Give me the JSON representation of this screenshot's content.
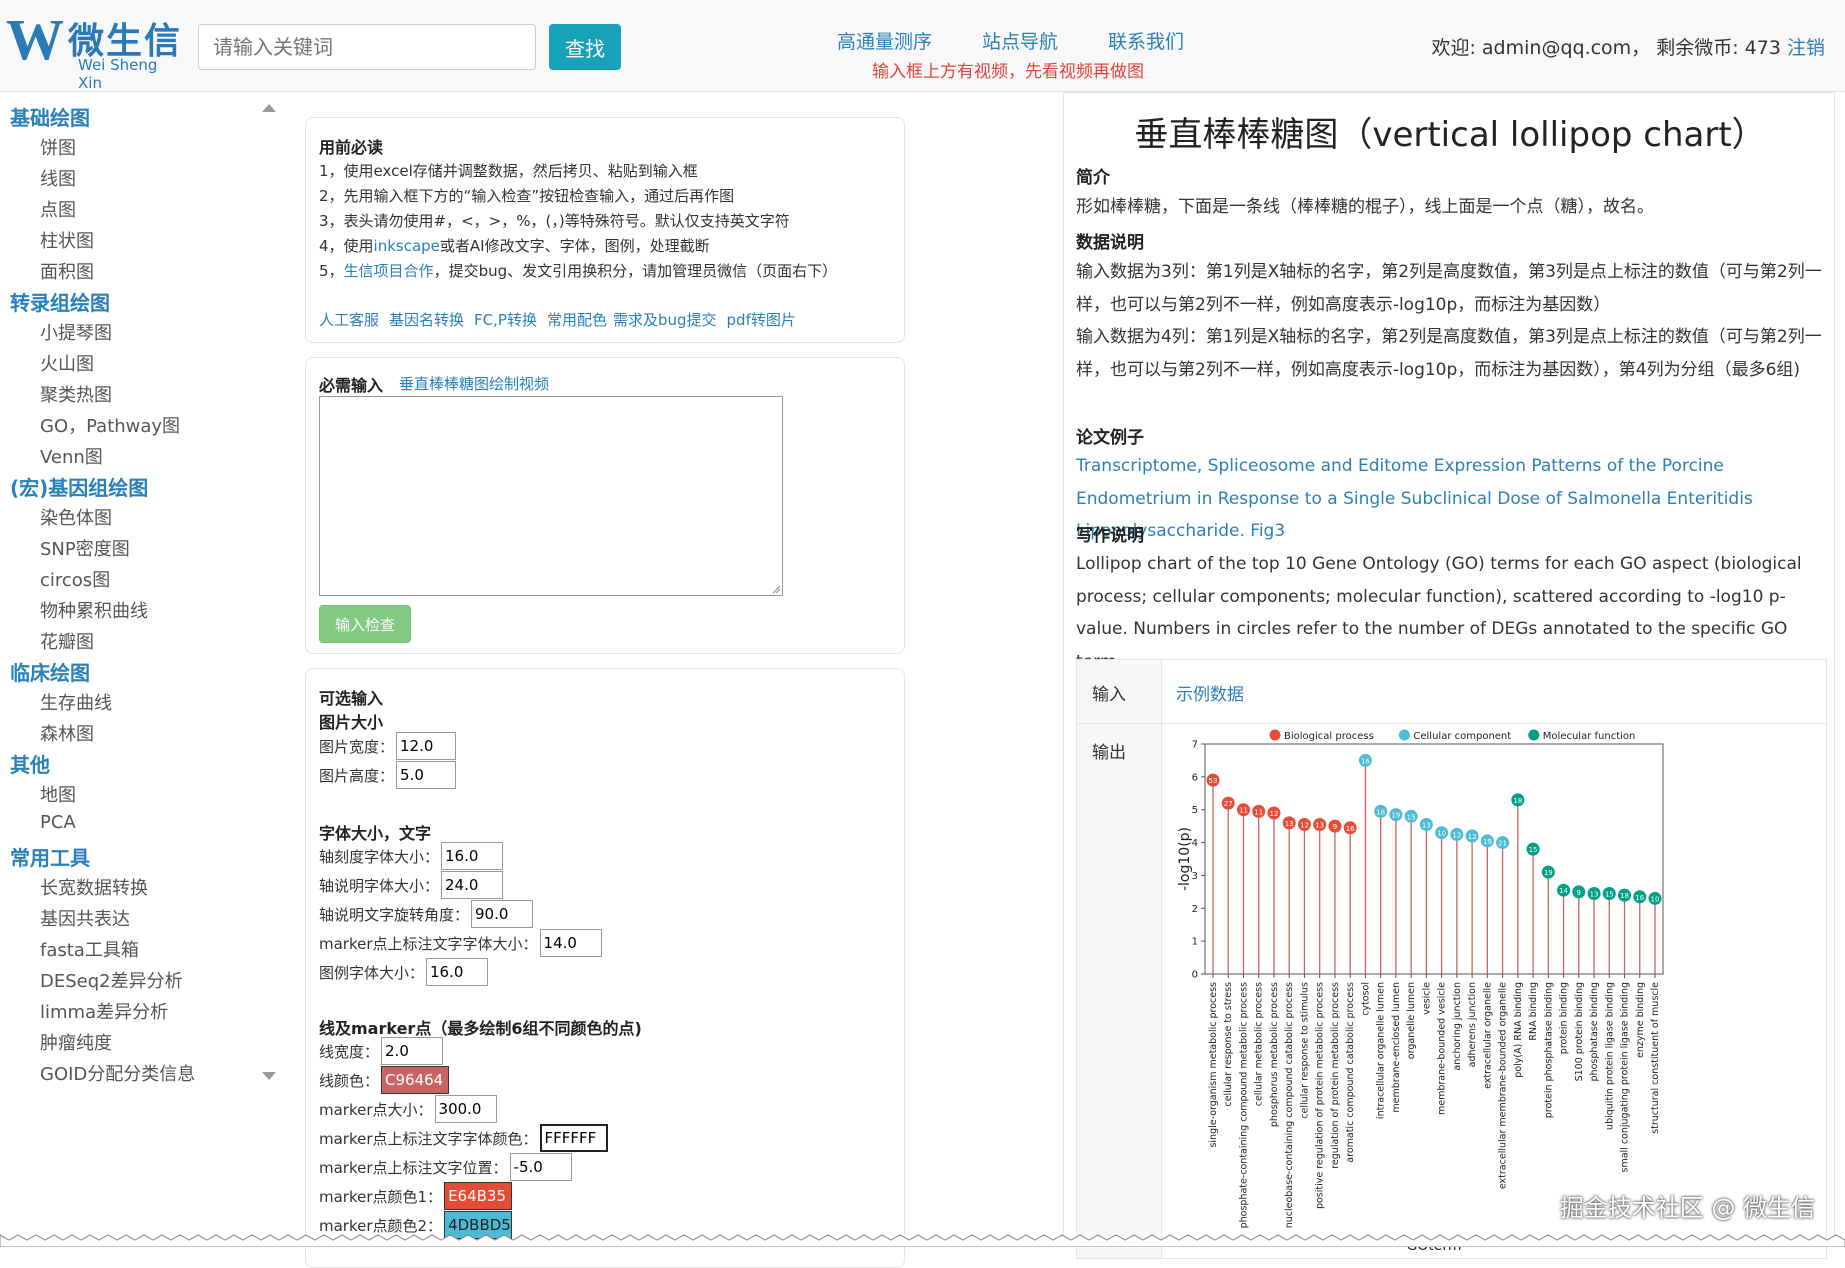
{
  "header": {
    "logo_cn": "微生信",
    "logo_en": "Wei Sheng Xin",
    "search_placeholder": "请输入关键词",
    "search_button": "查找",
    "nav": [
      "高通量测序",
      "站点导航",
      "联系我们"
    ],
    "notice": "输入框上方有视频，先看视频再做图",
    "welcome": "欢迎: admin@qq.com， 剩余微币: 473",
    "logout": "注销"
  },
  "sidebar": {
    "groups": [
      {
        "title": "基础绘图",
        "items": [
          "饼图",
          "线图",
          "点图",
          "柱状图",
          "面积图"
        ]
      },
      {
        "title": "转录组绘图",
        "items": [
          "小提琴图",
          "火山图",
          "聚类热图",
          "GO，Pathway图",
          "Venn图"
        ]
      },
      {
        "title": "(宏)基因组绘图",
        "items": [
          "染色体图",
          "SNP密度图",
          "circos图",
          "物种累积曲线",
          "花瓣图"
        ]
      },
      {
        "title": "临床绘图",
        "items": [
          "生存曲线",
          "森林图"
        ]
      },
      {
        "title": "其他",
        "items": [
          "地图",
          "PCA"
        ]
      },
      {
        "title": "常用工具",
        "items": [
          "长宽数据转换",
          "基因共表达",
          "fasta工具箱",
          "DESeq2差异分析",
          "limma差异分析",
          "肿瘤纯度",
          "GOID分配分类信息"
        ]
      }
    ]
  },
  "usage": {
    "title": "用前必读",
    "line1": "1，使用excel存储并调整数据，然后拷贝、粘贴到输入框",
    "line2": "2，先用输入框下方的“输入检查”按钮检查输入，通过后再作图",
    "line3": "3，表头请勿使用#，<，>，%，(，)等特殊符号。默认仅支持英文字符",
    "line4_a": "4，使用",
    "line4_link": "inkscape",
    "line4_b": "或者AI修改文字、字体，图例，处理截断",
    "line5_a": "5，",
    "line5_link": "生信项目合作",
    "line5_b": "，提交bug、发文引用换积分，请加管理员微信（页面右下）",
    "links": [
      "人工客服",
      "基因名转换",
      "FC,P转换",
      "常用配色",
      "需求及bug提交",
      "pdf转图片"
    ]
  },
  "required": {
    "title": "必需输入",
    "video_link": "垂直棒棒糖图绘制视频",
    "check_button": "输入检查"
  },
  "optional": {
    "title": "可选输入",
    "size_title": "图片大小",
    "width_label": "图片宽度：",
    "width_value": "12.0",
    "height_label": "图片高度：",
    "height_value": "5.0",
    "font_title": "字体大小，文字",
    "tick_label": "轴刻度字体大小：",
    "tick_value": "16.0",
    "axis_label": "轴说明字体大小：",
    "axis_value": "24.0",
    "rotate_label": "轴说明文字旋转角度：",
    "rotate_value": "90.0",
    "marker_font_label": "marker点上标注文字字体大小：",
    "marker_font_value": "14.0",
    "legend_font_label": "图例字体大小：",
    "legend_font_value": "16.0",
    "line_title": "线及marker点（最多绘制6组不同颜色的点)",
    "line_width_label": "线宽度：",
    "line_width_value": "2.0",
    "line_color_label": "线颜色：",
    "line_color_value": "C96464",
    "marker_size_label": "marker点大小：",
    "marker_size_value": "300.0",
    "marker_text_color_label": "marker点上标注文字字体颜色：",
    "marker_text_color_value": "FFFFFF",
    "marker_text_pos_label": "marker点上标注文字位置：",
    "marker_text_pos_value": "-5.0",
    "marker_color1_label": "marker点颜色1：",
    "marker_color1_value": "E64B35",
    "marker_color2_label": "marker点颜色2：",
    "marker_color2_value": "4DBBD5"
  },
  "info": {
    "title": "垂直棒棒糖图（vertical lollipop chart）",
    "intro_title": "简介",
    "intro_text": "形如棒棒糖，下面是一条线（棒棒糖的棍子），线上面是一个点（糖），故名。",
    "data_title": "数据说明",
    "data_text1": "输入数据为3列：第1列是X轴标的名字，第2列是高度数值，第3列是点上标注的数值（可与第2列一样，也可以与第2列不一样，例如高度表示-log10p，而标注为基因数）",
    "data_text2": "输入数据为4列：第1列是X轴标的名字，第2列是高度数值，第3列是点上标注的数值（可与第2列一样，也可以与第2列不一样，例如高度表示-log10p，而标注为基因数），第4列为分组（最多6组)",
    "paper_title": "论文例子",
    "paper_link": "Transcriptome, Spliceosome and Editome Expression Patterns of the Porcine Endometrium in Response to a Single Subclinical Dose of Salmonella Enteritidis Lipopolysaccharide. Fig3",
    "write_title": "写作说明",
    "write_text": "Lollipop chart of the top 10 Gene Ontology (GO) terms for each GO aspect (biological process; cellular components; molecular function), scattered according to -log10 p-value. Numbers in circles refer to the number of DEGs annotated to the specific GO term.",
    "input_label": "输入",
    "input_link": "示例数据",
    "output_label": "输出"
  },
  "chart_data": {
    "type": "scatter",
    "xlabel": "GOterm",
    "ylabel": "-log10(p)",
    "ylim": [
      0,
      7
    ],
    "yticks": [
      0,
      1,
      2,
      3,
      4,
      5,
      6,
      7
    ],
    "legend": [
      {
        "name": "Biological process",
        "color": "#E64B35"
      },
      {
        "name": "Cellular component",
        "color": "#4DBBD5"
      },
      {
        "name": "Molecular function",
        "color": "#00A087"
      }
    ],
    "line_color": "#C96464",
    "categories": [
      "single-organism metabolic process",
      "cellular response to stress",
      "phosphate-containing compound metabolic process",
      "cellular metabolic process",
      "phosphorus metabolic process",
      "nucleobase-containing compound catabolic process",
      "cellular response to stimulus",
      "positive regulation of protein metabolic process",
      "regulation of protein metabolic process",
      "aromatic compound catabolic process",
      "cytosol",
      "intracellular organelle lumen",
      "membrane-enclosed lumen",
      "organelle lumen",
      "vesicle",
      "membrane-bounded vesicle",
      "anchoring junction",
      "adherens junction",
      "extracellular organelle",
      "extracellular membrane-bounded organelle",
      "poly(A) RNA binding",
      "RNA binding",
      "protein phosphatase binding",
      "protein binding",
      "S100 protein binding",
      "phosphatase binding",
      "ubiquitin protein ligase binding",
      "small conjugating protein ligase binding",
      "enzyme binding",
      "structural constituent of muscle"
    ],
    "values": [
      5.9,
      5.2,
      5.0,
      4.95,
      4.9,
      4.6,
      4.55,
      4.55,
      4.5,
      4.45,
      6.5,
      4.95,
      4.85,
      4.8,
      4.55,
      4.3,
      4.25,
      4.2,
      4.05,
      4.0,
      5.3,
      3.8,
      3.1,
      2.55,
      2.5,
      2.45,
      2.45,
      2.4,
      2.35,
      2.3
    ],
    "labels": [
      "53",
      "27",
      "11",
      "11",
      "12",
      "13",
      "12",
      "13",
      "9",
      "16",
      "16",
      "18",
      "19",
      "15",
      "13",
      "10",
      "12",
      "12",
      "19",
      "21",
      "18",
      "15",
      "19",
      "14",
      "9",
      "13",
      "15",
      "18",
      "16",
      "10"
    ],
    "groups": [
      "Biological process",
      "Biological process",
      "Biological process",
      "Biological process",
      "Biological process",
      "Biological process",
      "Biological process",
      "Biological process",
      "Biological process",
      "Biological process",
      "Cellular component",
      "Cellular component",
      "Cellular component",
      "Cellular component",
      "Cellular component",
      "Cellular component",
      "Cellular component",
      "Cellular component",
      "Cellular component",
      "Cellular component",
      "Molecular function",
      "Molecular function",
      "Molecular function",
      "Molecular function",
      "Molecular function",
      "Molecular function",
      "Molecular function",
      "Molecular function",
      "Molecular function",
      "Molecular function"
    ]
  },
  "watermark": "掘金技术社区 @ 微生信"
}
